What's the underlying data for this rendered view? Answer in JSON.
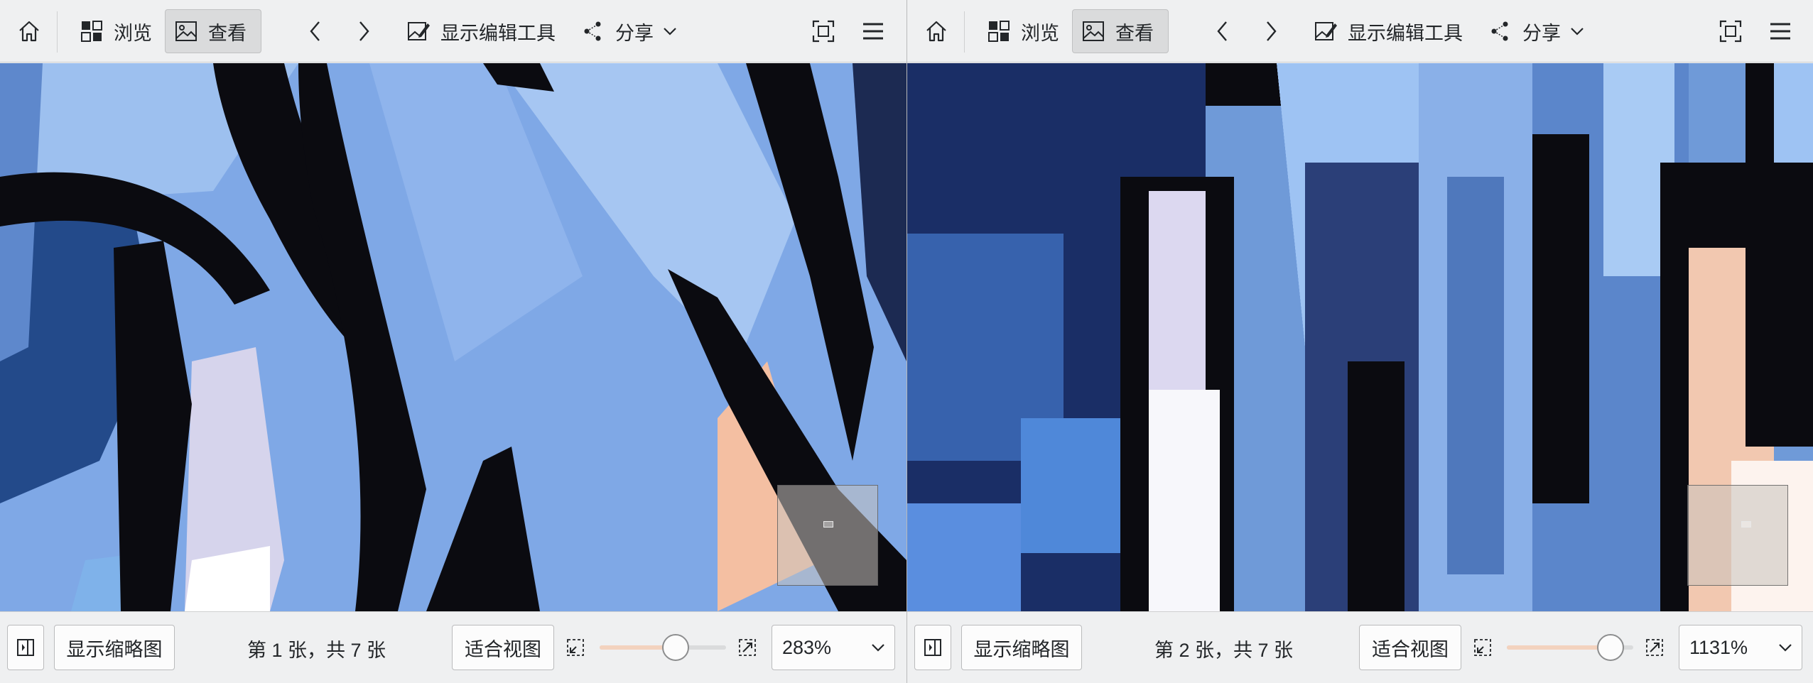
{
  "windows": [
    {
      "toolbar": {
        "home_icon": "home-icon",
        "browse_label": "浏览",
        "view_label": "查看",
        "edit_tools_label": "显示编辑工具",
        "share_label": "分享"
      },
      "status": {
        "thumbnails_label": "显示缩略图",
        "image_counter": "第 1 张，共 7 张",
        "fit_view_label": "适合视图",
        "zoom_value": "283%",
        "zoom_slider_fraction": 0.6
      }
    },
    {
      "toolbar": {
        "home_icon": "home-icon",
        "browse_label": "浏览",
        "view_label": "查看",
        "edit_tools_label": "显示编辑工具",
        "share_label": "分享"
      },
      "status": {
        "thumbnails_label": "显示缩略图",
        "image_counter": "第 2 张，共 7 张",
        "fit_view_label": "适合视图",
        "zoom_value": "1131%",
        "zoom_slider_fraction": 0.82
      }
    }
  ],
  "colors": {
    "accent_slider": "#f3d2be",
    "toolbar_bg": "#eff0f1",
    "active_button_bg": "#dadbdc"
  }
}
